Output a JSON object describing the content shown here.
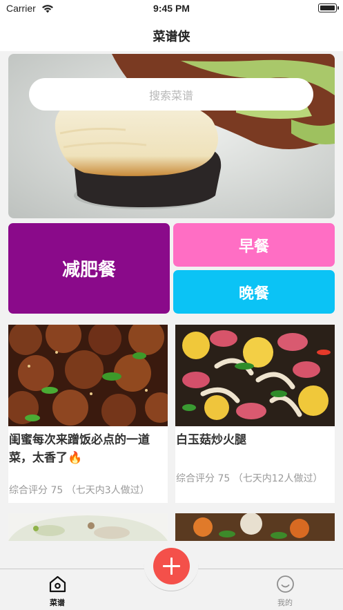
{
  "status_bar": {
    "carrier": "Carrier",
    "time": "9:45 PM"
  },
  "nav": {
    "title": "菜谱侠"
  },
  "search": {
    "placeholder": "搜索菜谱"
  },
  "categories": [
    {
      "label": "减肥餐",
      "color": "#8a0a8a"
    },
    {
      "label": "早餐",
      "color": "#ff6ec4"
    },
    {
      "label": "晚餐",
      "color": "#0bc3f5"
    }
  ],
  "recipes": [
    {
      "title": "闺蜜每次来蹭饭必点的一道菜，太香了🔥",
      "meta": "综合评分 75 （七天内3人做过）"
    },
    {
      "title": "白玉菇炒火腿",
      "meta": "综合评分 75 （七天内12人做过）"
    }
  ],
  "tabs": [
    {
      "label": "菜谱",
      "icon": "home-icon",
      "active": true
    },
    {
      "label": "我的",
      "icon": "smile-icon",
      "active": false
    }
  ],
  "colors": {
    "accent": "#f4504a",
    "background": "#f2f2f2"
  }
}
